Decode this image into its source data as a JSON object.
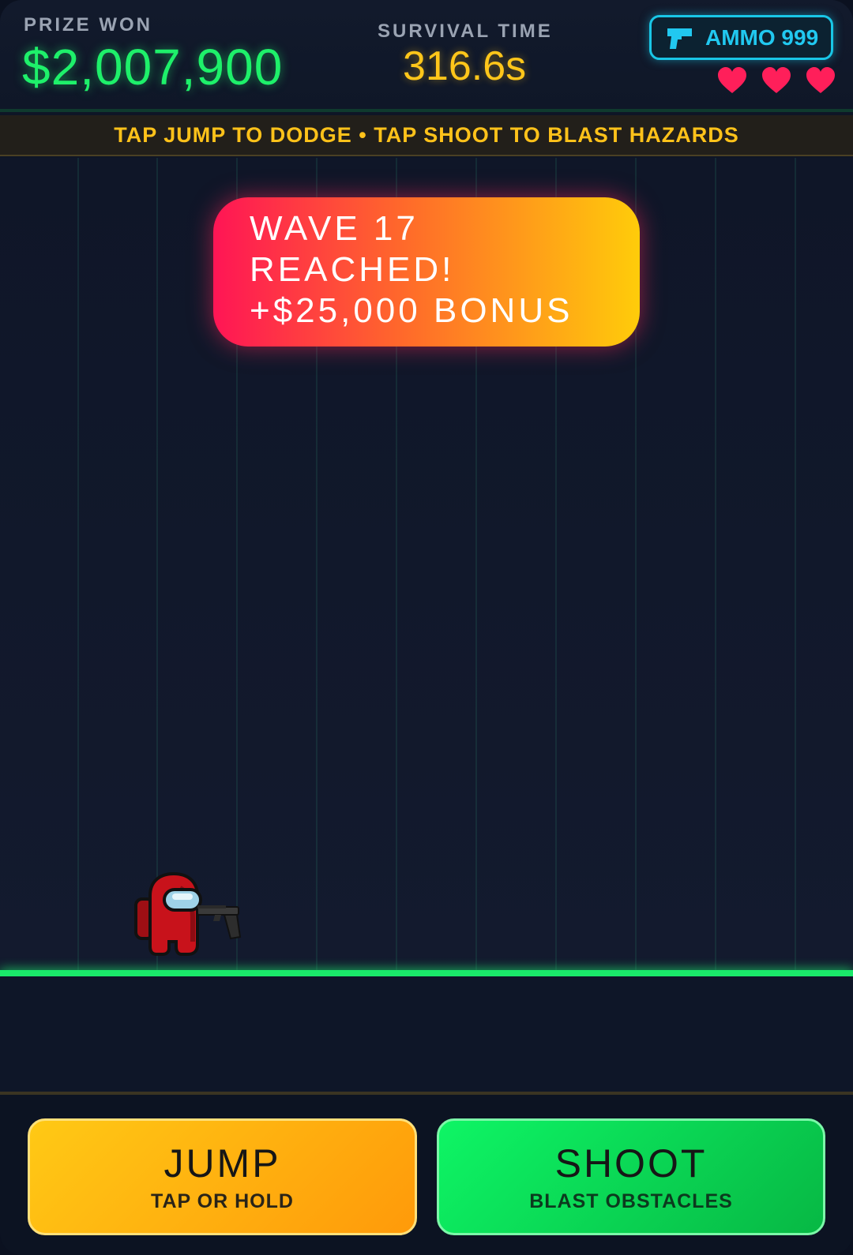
{
  "hud": {
    "prize_label": "PRIZE WON",
    "prize_value": "$2,007,900",
    "time_label": "SURVIVAL TIME",
    "time_value": "316.6s",
    "ammo_text": "AMMO 999",
    "lives": 3
  },
  "banner": {
    "text": "TAP JUMP TO DODGE • TAP SHOOT TO BLAST HAZARDS"
  },
  "toast": {
    "line1": "WAVE 17",
    "line2": "REACHED!",
    "line3": "+$25,000 BONUS"
  },
  "controls": {
    "jump_title": "JUMP",
    "jump_sub": "TAP OR HOLD",
    "shoot_title": "SHOOT",
    "shoot_sub": "BLAST OBSTACLES"
  },
  "icons": {
    "ammo": "pistol-icon",
    "life": "heart-icon",
    "player": "crewmate-character"
  },
  "colors": {
    "prize": "#1ef06a",
    "time": "#ffc61a",
    "ammo": "#21c8f0",
    "heart": "#ff1f5a",
    "ground": "#1ae86a",
    "jump_button": "#ffc915",
    "shoot_button": "#0ef565"
  }
}
